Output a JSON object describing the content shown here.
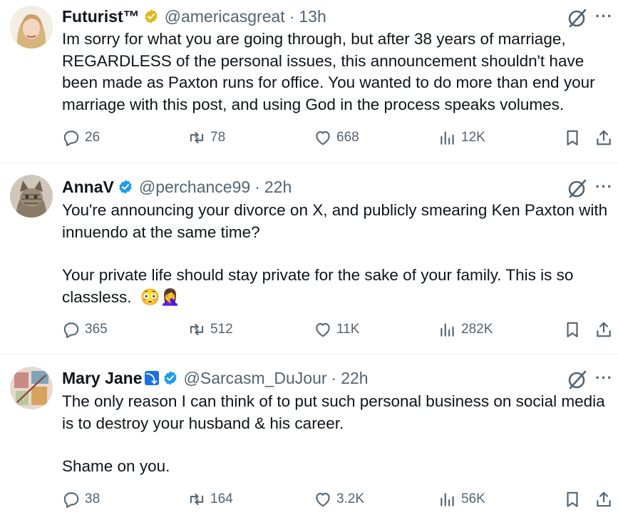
{
  "tweets": [
    {
      "name": "Futurist™",
      "verified": "gold",
      "handle": "@americasgreat",
      "separator": "·",
      "time": "13h",
      "paragraphs": [
        "Im sorry for what you are going through, but after 38 years of marriage, REGARDLESS of the personal issues, this announcement shouldn't have been made as Paxton runs for office. You wanted to do more than end your marriage with this post, and using God in the process speaks volumes."
      ],
      "stats": {
        "replies": "26",
        "reposts": "78",
        "likes": "668",
        "views": "12K"
      }
    },
    {
      "name": "AnnaV",
      "verified": "blue",
      "handle": "@perchance99",
      "separator": "·",
      "time": "22h",
      "paragraphs": [
        "You're announcing your divorce on X, and publicly smearing Ken Paxton with innuendo at the same time?",
        "Your private life should stay private for the sake of your family.  This is so classless."
      ],
      "emojis": "😳🤦‍♀️",
      "stats": {
        "replies": "365",
        "reposts": "512",
        "likes": "11K",
        "views": "282K"
      }
    },
    {
      "name": "Mary Jane",
      "name_emoji": "⤵",
      "verified": "blue",
      "handle": "@Sarcasm_DuJour",
      "separator": "·",
      "time": "22h",
      "paragraphs": [
        "The only reason I can think of to put such personal business on social media is to destroy your husband & his career.",
        "Shame on you."
      ],
      "stats": {
        "replies": "38",
        "reposts": "164",
        "likes": "3.2K",
        "views": "56K"
      }
    }
  ],
  "more_label": "···",
  "colors": {
    "text": "#0f1419",
    "muted": "#536471",
    "verified_blue": "#1d9bf0",
    "verified_gold": "#e2b719",
    "divider": "#eff3f4"
  }
}
